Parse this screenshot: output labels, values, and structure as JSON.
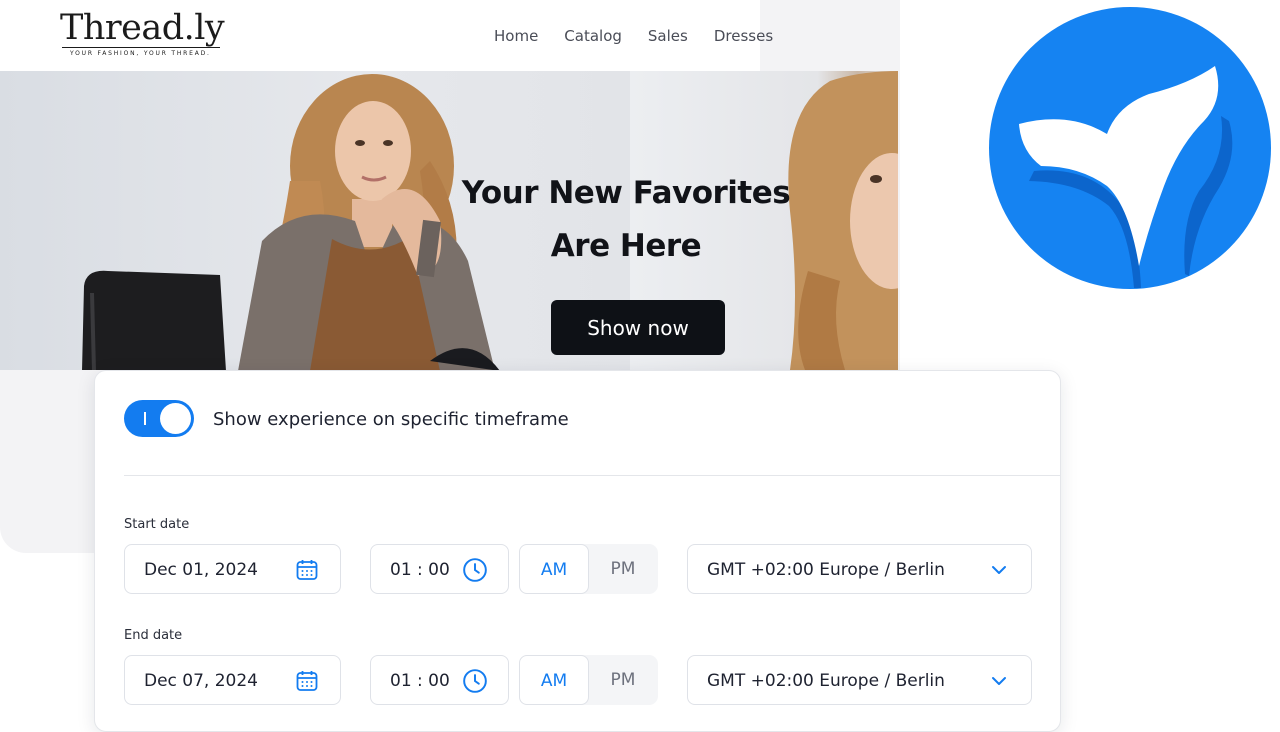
{
  "site": {
    "logo": {
      "name": "Thread.ly",
      "tagline": "YOUR FASHION, YOUR THREAD."
    },
    "nav": [
      "Home",
      "Catalog",
      "Sales",
      "Dresses"
    ],
    "hero": {
      "title_line1": "Your New Favorites",
      "title_line2": "Are Here",
      "cta": "Show now"
    }
  },
  "brand_icon": "whale-tail-logo-icon",
  "colors": {
    "accent": "#137cf0",
    "brand_circle": "#1583f2",
    "cta_bg": "#0e1116",
    "text": "#1e2230"
  },
  "settings": {
    "toggle": {
      "label": "Show experience on specific timeframe",
      "enabled": true
    },
    "start": {
      "label": "Start date",
      "date": "Dec 01, 2024",
      "time": "01 : 00",
      "am": "AM",
      "pm": "PM",
      "selected": "AM",
      "timezone": "GMT +02:00 Europe / Berlin"
    },
    "end": {
      "label": "End date",
      "date": "Dec 07, 2024",
      "time": "01 : 00",
      "am": "AM",
      "pm": "PM",
      "selected": "AM",
      "timezone": "GMT +02:00 Europe / Berlin"
    }
  }
}
